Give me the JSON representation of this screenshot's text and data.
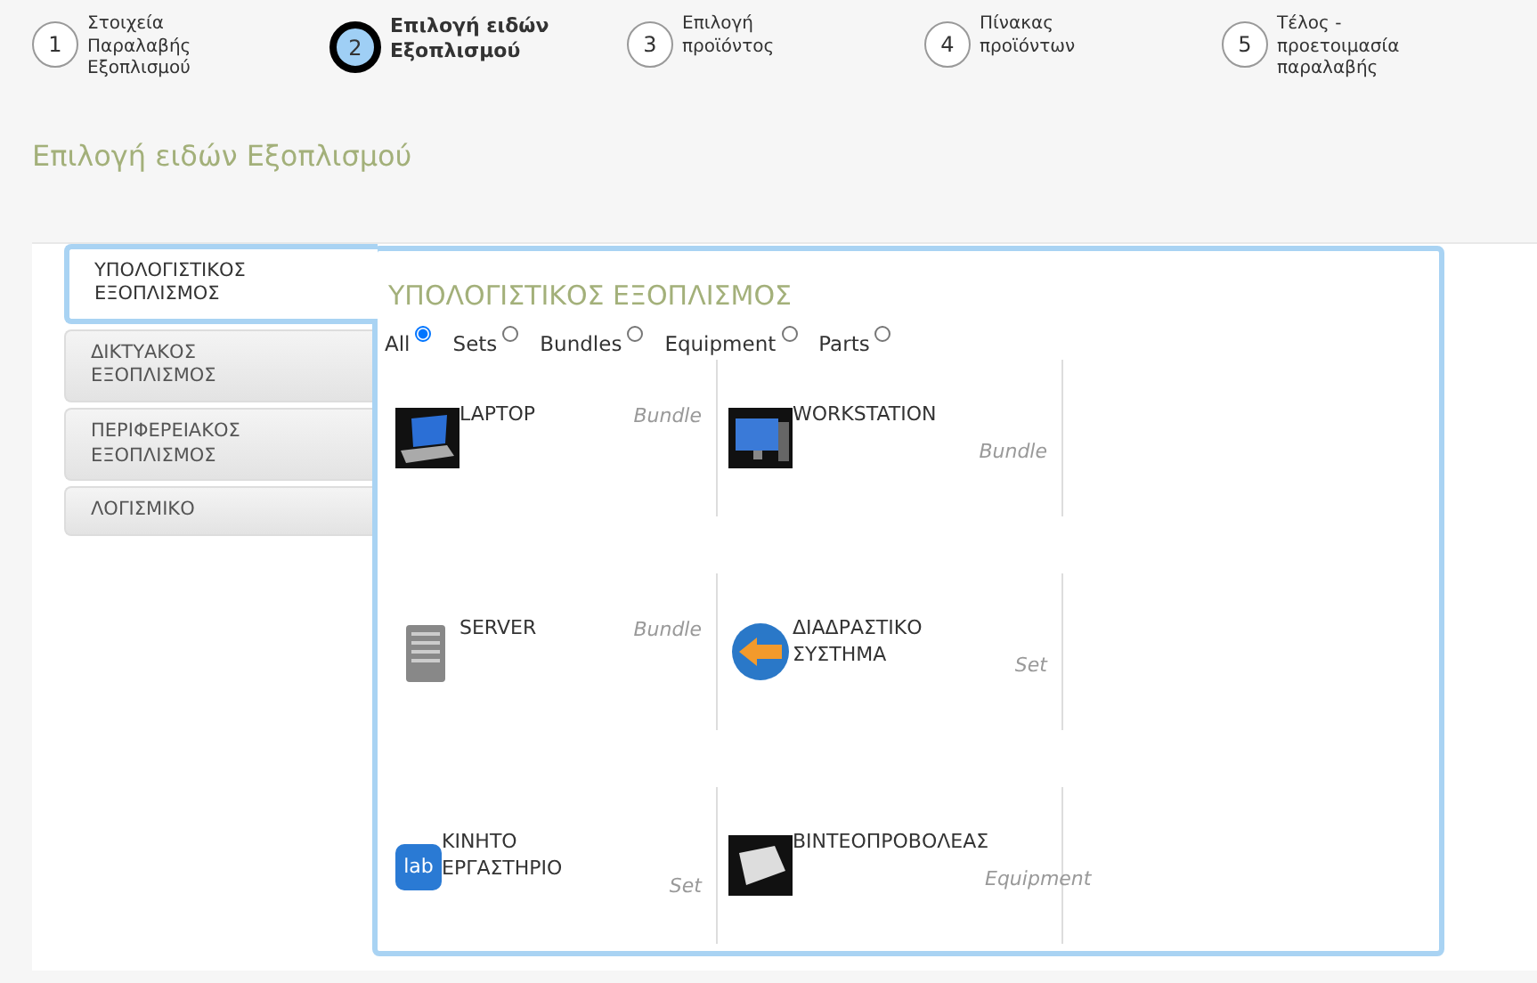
{
  "steps": [
    {
      "number": "1",
      "label": "Στοιχεία Παραλαβής Εξοπλισμού",
      "selected": false
    },
    {
      "number": "2",
      "label": "Επιλογή ειδών Εξοπλισμού",
      "selected": true
    },
    {
      "number": "3",
      "label": "Επιλογή προϊόντος",
      "selected": false
    },
    {
      "number": "4",
      "label": "Πίνακας προϊόντων",
      "selected": false
    },
    {
      "number": "5",
      "label": "Τέλος - προετοιμασία παραλαβής",
      "selected": false
    }
  ],
  "page_title": "Επιλογή ειδών Εξοπλισμού",
  "categories": [
    {
      "label": "ΥΠΟΛΟΓΙΣΤΙΚΟΣ ΕΞΟΠΛΙΣΜΟΣ",
      "selected": true
    },
    {
      "label": "ΔΙΚΤΥΑΚΟΣ ΕΞΟΠΛΙΣΜΟΣ",
      "selected": false
    },
    {
      "label": "ΠΕΡΙΦΕΡΕΙΑΚΟΣ ΕΞΟΠΛΙΣΜΟΣ",
      "selected": false
    },
    {
      "label": "ΛΟΓΙΣΜΙΚΟ",
      "selected": false
    }
  ],
  "panel_title": "ΥΠΟΛΟΓΙΣΤΙΚΟΣ ΕΞΟΠΛΙΣΜΟΣ",
  "filters": [
    {
      "label": "All",
      "selected": true
    },
    {
      "label": "Sets",
      "selected": false
    },
    {
      "label": "Bundles",
      "selected": false
    },
    {
      "label": "Equipment",
      "selected": false
    },
    {
      "label": "Parts",
      "selected": false
    }
  ],
  "products": [
    {
      "name": "LAPTOP",
      "type": "Bundle",
      "kind": "laptop"
    },
    {
      "name": "WORKSTATION",
      "type": "Bundle",
      "kind": "workstation"
    },
    {
      "name": "SERVER",
      "type": "Bundle",
      "kind": "server"
    },
    {
      "name": "ΔΙΑΔΡΑΣΤΙΚΟ ΣΥΣΤΗΜΑ",
      "type": "Set",
      "kind": "interactive"
    },
    {
      "name": "ΚΙΝΗΤΟ ΕΡΓΑΣΤΗΡΙΟ",
      "type": "Set",
      "kind": "lab",
      "icon_text": "lab"
    },
    {
      "name": "ΒΙΝΤΕΟΠΡΟΒΟΛΕΑΣ",
      "type": "Equipment",
      "kind": "projector"
    }
  ]
}
